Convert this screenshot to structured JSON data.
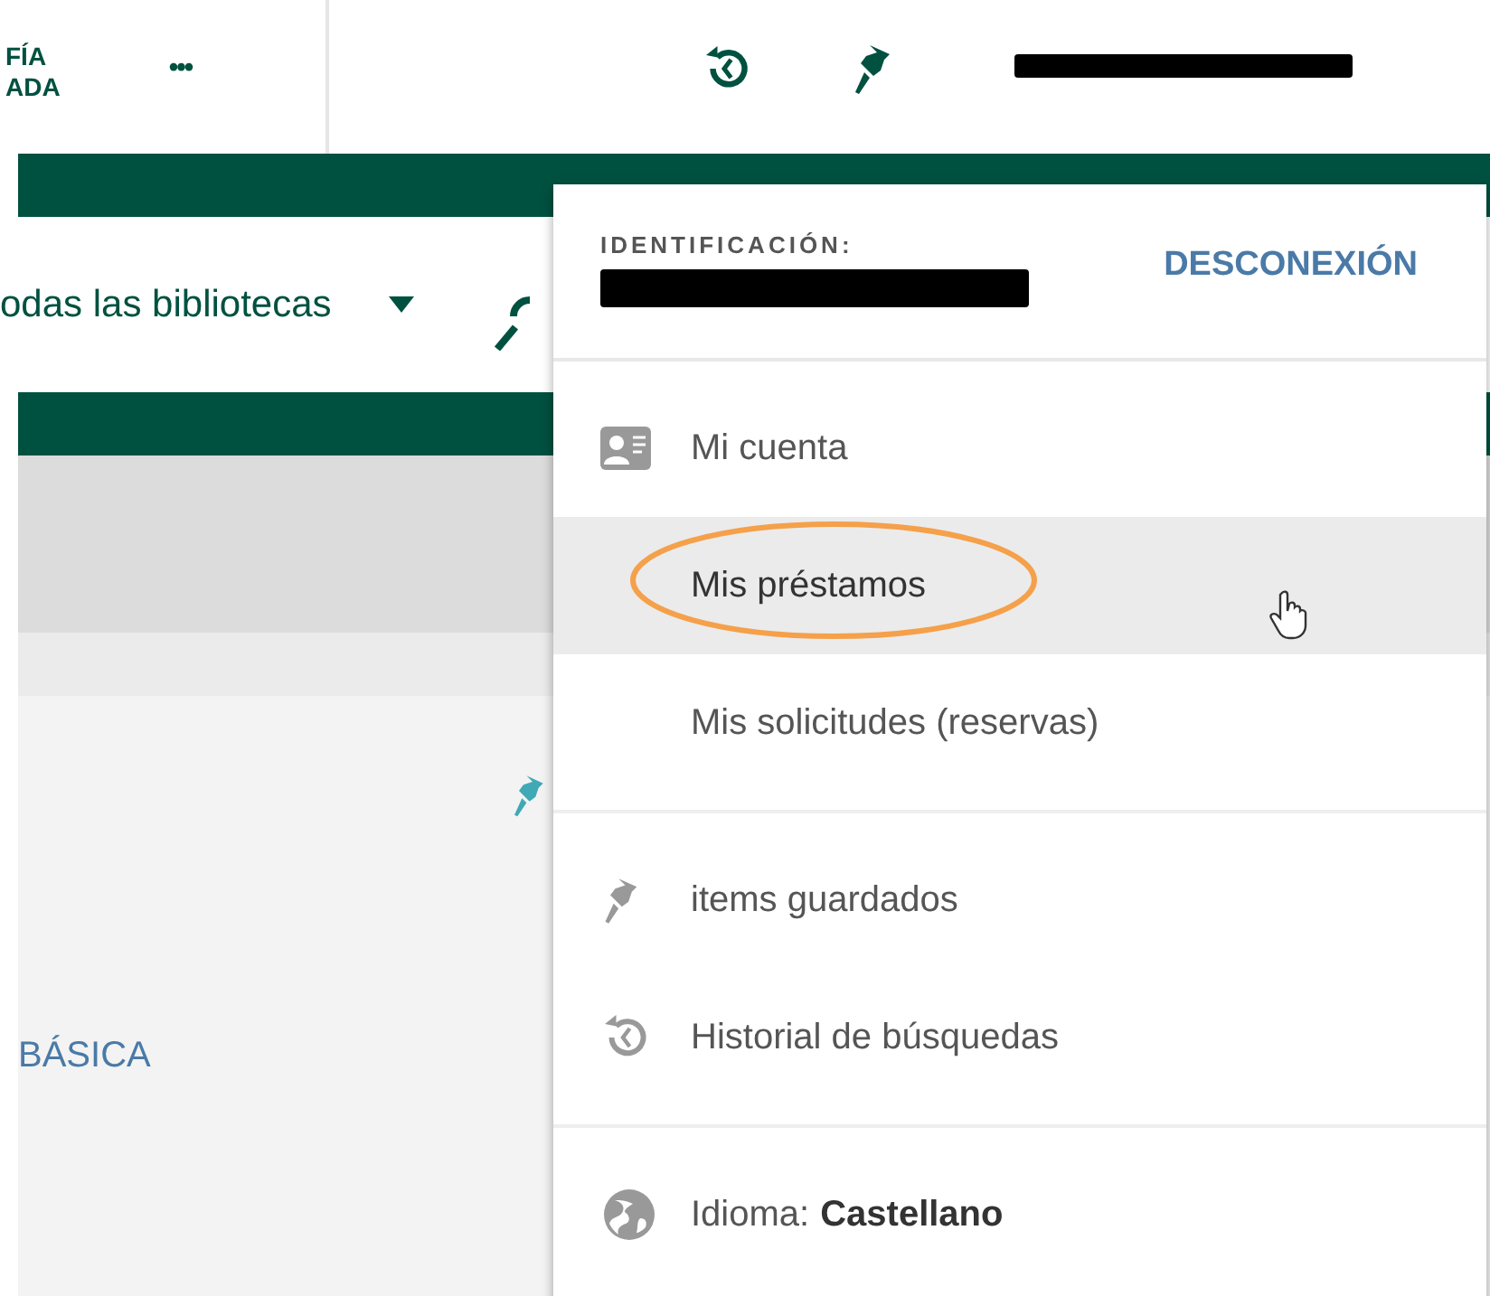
{
  "header": {
    "title_lines": [
      "FÍA",
      "ADA"
    ],
    "more_label": "•••"
  },
  "search": {
    "scope": "odas las bibliotecas"
  },
  "content": {
    "link": "BÁSICA"
  },
  "user_menu": {
    "id_label": "IDENTIFICACIÓN:",
    "logout": "DESCONEXIÓN",
    "sections": [
      {
        "items": [
          {
            "kind": "account",
            "label": "Mi cuenta",
            "selected": false
          },
          {
            "kind": "plain",
            "label": "Mis préstamos",
            "selected": true
          },
          {
            "kind": "plain",
            "label": "Mis solicitudes (reservas)",
            "selected": false
          }
        ]
      },
      {
        "items": [
          {
            "kind": "pin",
            "label": "items guardados",
            "selected": false
          },
          {
            "kind": "history",
            "label": "Historial de búsquedas",
            "selected": false
          }
        ]
      },
      {
        "items": [
          {
            "kind": "language",
            "label": "Idioma:",
            "value": "Castellano",
            "selected": false
          }
        ]
      }
    ]
  }
}
